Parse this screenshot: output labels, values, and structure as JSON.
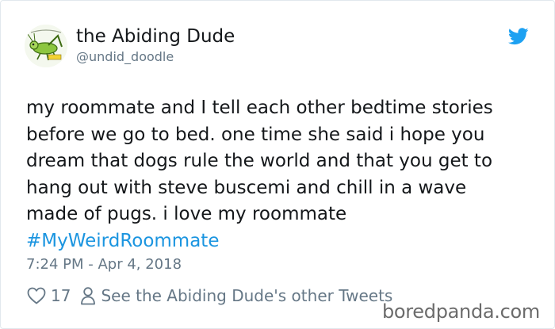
{
  "tweet": {
    "author_name": "the Abiding Dude",
    "author_handle": "@undid_doodle",
    "body_lines": [
      "my roommate and I tell each other bedtime stories",
      "before we go to bed. one time she said i hope you",
      "dream that dogs rule the world and that you get to",
      "hang out with steve buscemi and chill in a wave",
      "made of pugs. i love my roommate"
    ],
    "hashtag": "#MyWeirdRoommate",
    "timestamp": "7:24 PM - Apr 4, 2018",
    "like_count": "17",
    "other_tweets_link": "See the Abiding Dude's other Tweets"
  },
  "icons": {
    "avatar": "grasshopper-avatar",
    "brand": "twitter-bird-icon",
    "like": "heart-icon",
    "profile": "person-icon"
  },
  "colors": {
    "text": "#14171a",
    "secondary": "#657786",
    "link": "#1b95e0",
    "twitter_blue": "#1da1f2",
    "watermark": "#6b6b6b"
  },
  "watermark": "boredpanda.com"
}
